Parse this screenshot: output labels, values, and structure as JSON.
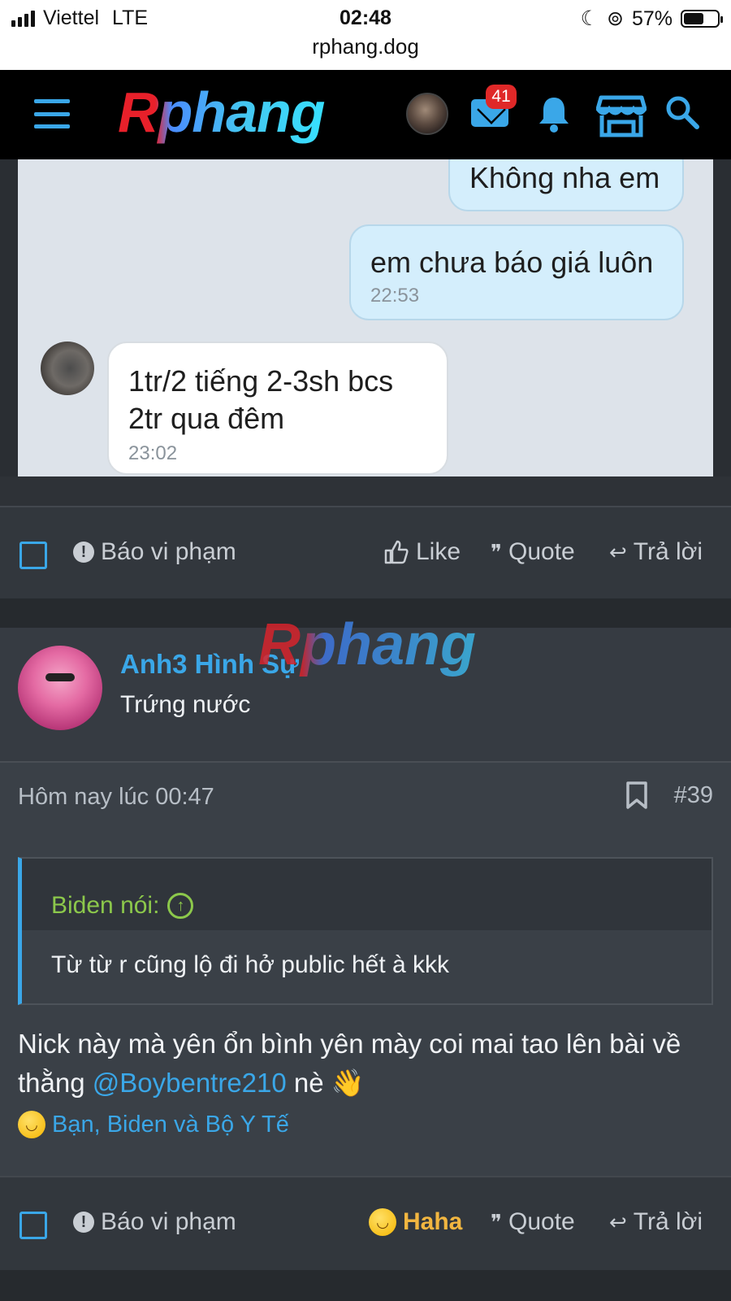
{
  "status_bar": {
    "carrier": "Viettel",
    "network": "LTE",
    "time": "02:48",
    "url": "rphang.dog",
    "battery": "57%"
  },
  "nav": {
    "logo": "Rphang",
    "mail_badge": "41"
  },
  "chat": {
    "messages": [
      {
        "text": "Không nha em",
        "time": ""
      },
      {
        "text": "em chưa báo giá luôn",
        "time": "22:53"
      },
      {
        "line1": "1tr/2 tiếng 2-3sh bcs",
        "line2": "2tr qua đêm",
        "time": "23:02"
      }
    ]
  },
  "post1_actions": {
    "report": "Báo vi phạm",
    "like": "Like",
    "quote": "Quote",
    "reply": "Trả lời"
  },
  "post2": {
    "watermark": "Rphang",
    "author": "Anh3 Hình Sự",
    "user_title": "Trứng nước",
    "date": "Hôm nay lúc 00:47",
    "post_number": "#39",
    "quote_author": "Biden nói:",
    "quote_text": "Từ từ r cũng lộ đi hở public hết à kkk",
    "message_before": "Nick này mà yên ổn bình yên mày coi mai tao lên bài về thằng ",
    "mention": "@Boybentre210",
    "message_after": " nè ",
    "reactions_text": "Bạn, Biden và Bộ Y Tế",
    "actions": {
      "report": "Báo vi phạm",
      "reaction": "Haha",
      "quote": "Quote",
      "reply": "Trả lời"
    }
  },
  "colors": {
    "accent": "#3aa7e8",
    "quote_green": "#8cc84b",
    "haha": "#f2b640",
    "badge_red": "#e02828"
  }
}
